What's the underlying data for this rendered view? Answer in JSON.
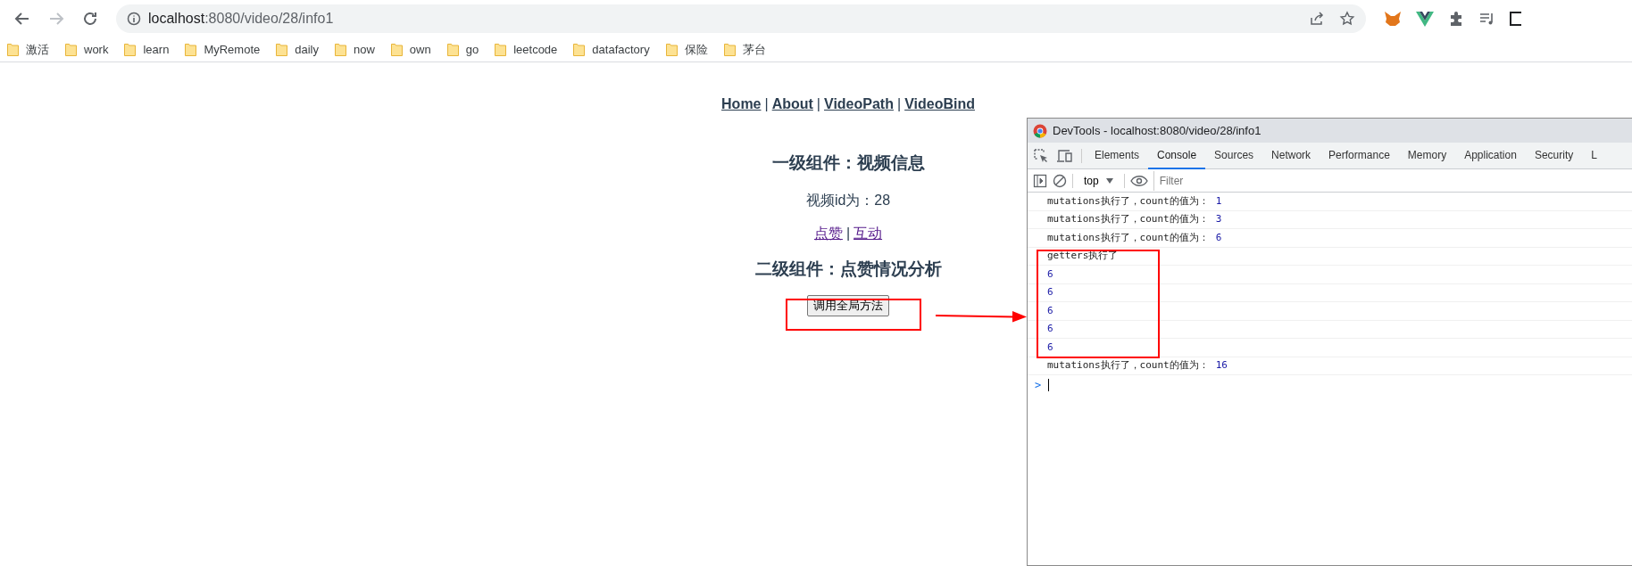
{
  "browser": {
    "url_host": "localhost",
    "url_rest": ":8080/video/28/info1",
    "back_disabled": false,
    "forward_disabled": true
  },
  "bookmarks": [
    "激活",
    "work",
    "learn",
    "MyRemote",
    "daily",
    "now",
    "own",
    "go",
    "leetcode",
    "datafactory",
    "保险",
    "茅台"
  ],
  "page": {
    "nav": [
      "Home",
      "About",
      "VideoPath",
      "VideoBind"
    ],
    "separator": "|",
    "heading_1": "一级组件：视频信息",
    "id_text": "视频id为：28",
    "sub_links": [
      "点赞",
      "互动"
    ],
    "heading_2": "二级组件：点赞情况分析",
    "button": "调用全局方法"
  },
  "devtools": {
    "title": "DevTools - localhost:8080/video/28/info1",
    "tabs": [
      {
        "label": "Elements",
        "selected": false
      },
      {
        "label": "Console",
        "selected": true
      },
      {
        "label": "Sources",
        "selected": false
      },
      {
        "label": "Network",
        "selected": false
      },
      {
        "label": "Performance",
        "selected": false
      },
      {
        "label": "Memory",
        "selected": false
      },
      {
        "label": "Application",
        "selected": false
      },
      {
        "label": "Security",
        "selected": false
      },
      {
        "label": "L",
        "selected": false
      }
    ],
    "context": "top",
    "filter_placeholder": "Filter",
    "rows": [
      {
        "text": "mutations执行了，count的值为：",
        "value": "1"
      },
      {
        "text": "mutations执行了，count的值为：",
        "value": "3"
      },
      {
        "text": "mutations执行了，count的值为：",
        "value": "6"
      },
      {
        "text": "getters执行了"
      },
      {
        "value": "6"
      },
      {
        "value": "6"
      },
      {
        "value": "6"
      },
      {
        "value": "6"
      },
      {
        "value": "6"
      },
      {
        "text": "mutations执行了，count的值为：",
        "value": "16"
      }
    ],
    "prompt": ">"
  }
}
